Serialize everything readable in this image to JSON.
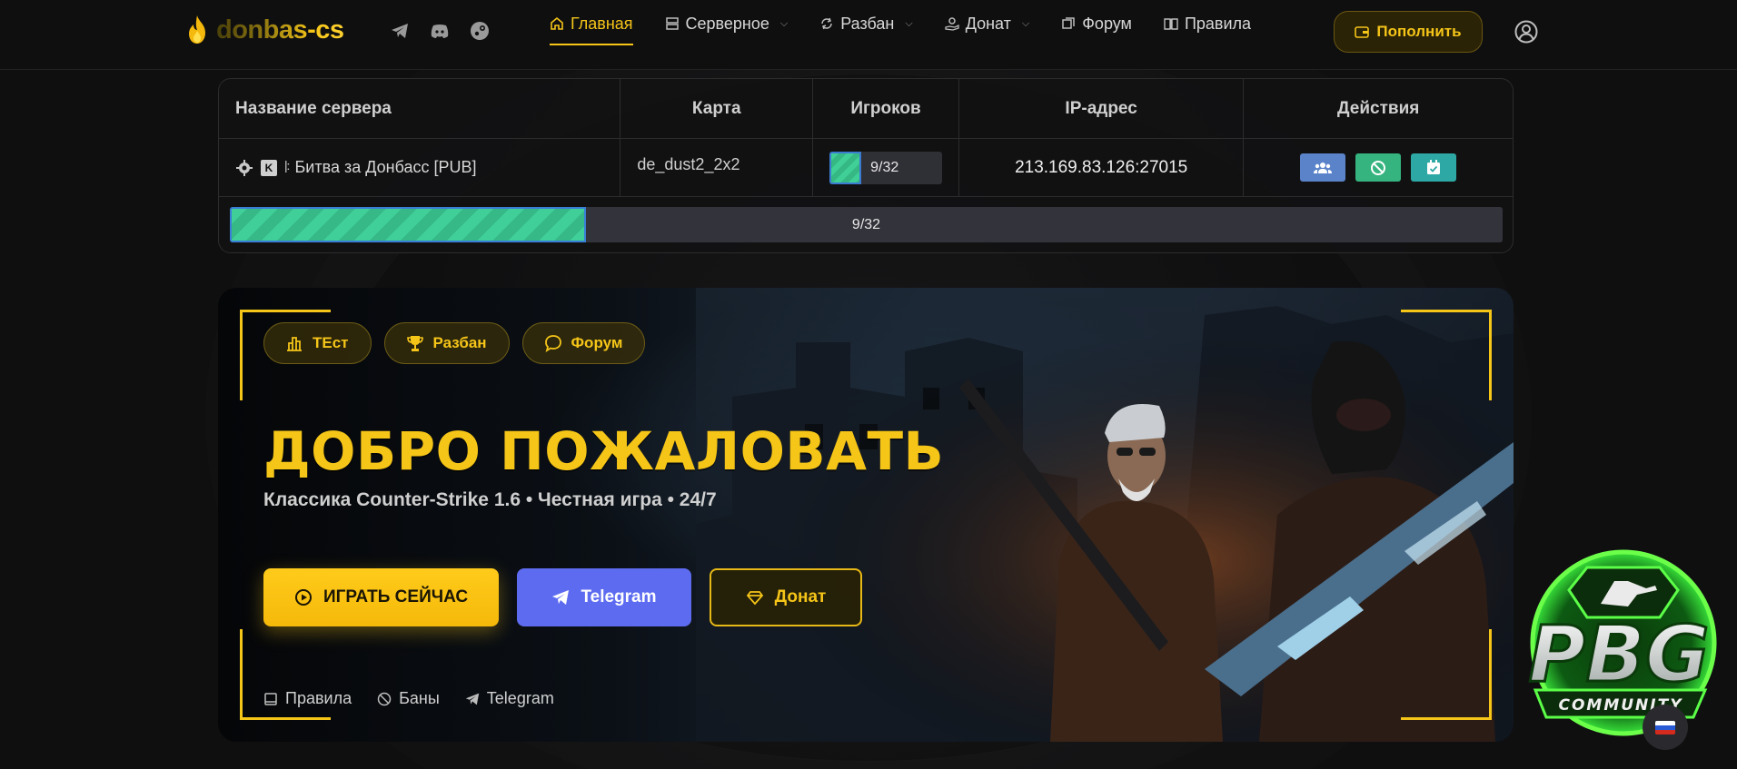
{
  "header": {
    "brand": "donbas-cs",
    "social": [
      "telegram-icon",
      "discord-icon",
      "steam-icon"
    ],
    "nav": [
      {
        "label": "Главная",
        "icon": "home-icon",
        "active": true,
        "dropdown": false
      },
      {
        "label": "Серверное",
        "icon": "server-icon",
        "active": false,
        "dropdown": true
      },
      {
        "label": "Разбан",
        "icon": "unban-icon",
        "active": false,
        "dropdown": true
      },
      {
        "label": "Донат",
        "icon": "donate-icon",
        "active": false,
        "dropdown": true
      },
      {
        "label": "Форум",
        "icon": "forum-icon",
        "active": false,
        "dropdown": false
      },
      {
        "label": "Правила",
        "icon": "book-icon",
        "active": false,
        "dropdown": false
      }
    ],
    "topup_label": "Пополнить"
  },
  "servers": {
    "headers": [
      "Название сервера",
      "Карта",
      "Игроков",
      "IP-адрес",
      "Действия"
    ],
    "rows": [
      {
        "name": "ꖎ Битва за Донбасс [PUB]",
        "map": "de_dust2_2x2",
        "players": "9/32",
        "players_fraction": 0.28,
        "ip": "213.169.83.126:27015"
      }
    ],
    "total_players": "9/32",
    "total_fraction": 0.28
  },
  "hero": {
    "pills": [
      "ТЕст",
      "Разбан",
      "Форум"
    ],
    "title": "ДОБРО ПОЖАЛОВАТЬ",
    "subtitle": "Классика Counter-Strike 1.6 • Честная игра • 24/7",
    "cta": {
      "play": "ИГРАТЬ СЕЙЧАС",
      "telegram": "Telegram",
      "donate": "Донат"
    },
    "links": [
      "Правила",
      "Баны",
      "Telegram"
    ]
  },
  "logo": {
    "text": "PBG",
    "sub": "COMMUNITY"
  },
  "colors": {
    "accent": "#f5c518",
    "telegram": "#5d6bf0",
    "progress": "#40cf98"
  }
}
